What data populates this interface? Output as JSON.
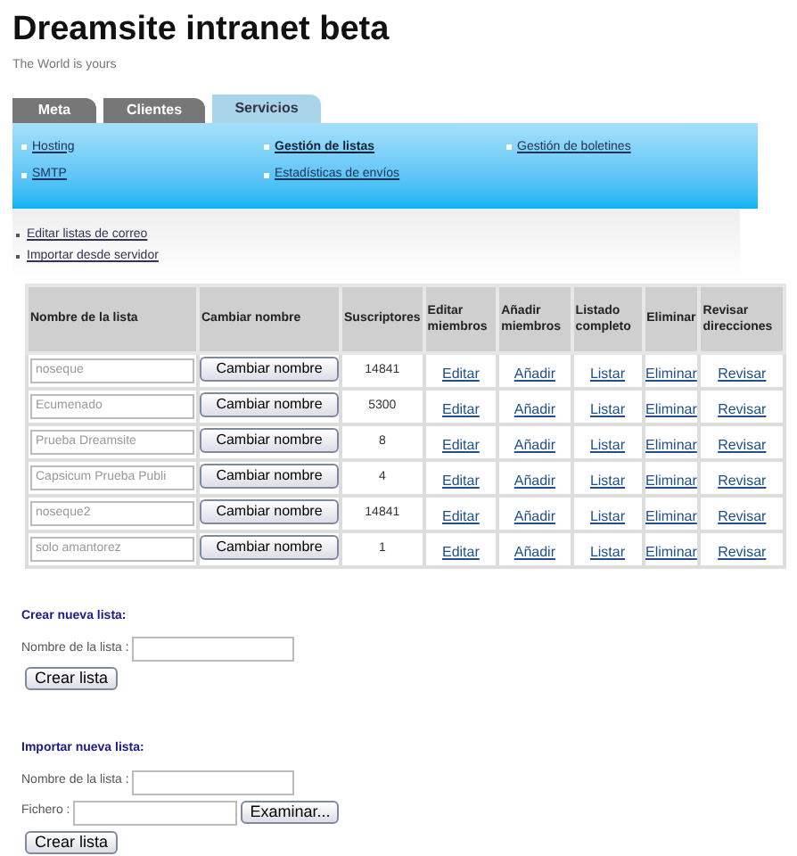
{
  "site": {
    "title": "Dreamsite intranet beta",
    "tagline": "The World is yours"
  },
  "tabs": [
    {
      "label": "Meta",
      "selected": false
    },
    {
      "label": "Clientes",
      "selected": false
    },
    {
      "label": "Servicios",
      "selected": true
    }
  ],
  "subnav": [
    {
      "label": "Hosting",
      "selected": false
    },
    {
      "label": "Gestión de listas",
      "selected": true
    },
    {
      "label": "Gestión de boletines",
      "selected": false
    },
    {
      "label": "SMTP",
      "selected": false
    },
    {
      "label": "Estadísticas de envíos",
      "selected": false
    }
  ],
  "side_links": [
    "Editar listas de correo",
    "Importar desde servidor"
  ],
  "table": {
    "columns": [
      "Nombre de la lista",
      "Cambiar nombre",
      "Suscriptores",
      "Editar miembros",
      "Añadir miembros",
      "Listado completo",
      "Eliminar",
      "Revisar direcciones"
    ],
    "rows": [
      {
        "name": "noseque",
        "button": "Cambiar nombre",
        "subscribers": "14841",
        "edit": "Editar",
        "add": "Añadir",
        "list": "Listar",
        "delete": "Eliminar",
        "review": "Revisar"
      },
      {
        "name": "Ecumenado",
        "button": "Cambiar nombre",
        "subscribers": "5300",
        "edit": "Editar",
        "add": "Añadir",
        "list": "Listar",
        "delete": "Eliminar",
        "review": "Revisar"
      },
      {
        "name": "Prueba Dreamsite",
        "button": "Cambiar nombre",
        "subscribers": "8",
        "edit": "Editar",
        "add": "Añadir",
        "list": "Listar",
        "delete": "Eliminar",
        "review": "Revisar"
      },
      {
        "name": "Capsicum Prueba Publi",
        "button": "Cambiar nombre",
        "subscribers": "4",
        "edit": "Editar",
        "add": "Añadir",
        "list": "Listar",
        "delete": "Eliminar",
        "review": "Revisar"
      },
      {
        "name": "noseque2",
        "button": "Cambiar nombre",
        "subscribers": "14841",
        "edit": "Editar",
        "add": "Añadir",
        "list": "Listar",
        "delete": "Eliminar",
        "review": "Revisar"
      },
      {
        "name": "solo amantorez",
        "button": "Cambiar nombre",
        "subscribers": "1",
        "edit": "Editar",
        "add": "Añadir",
        "list": "Listar",
        "delete": "Eliminar",
        "review": "Revisar"
      }
    ]
  },
  "create_form": {
    "heading": "Crear nueva lista:",
    "name_label": "Nombre de la lista :",
    "submit": "Crear lista"
  },
  "import_form": {
    "heading": "Importar nueva lista:",
    "name_label": "Nombre de la lista :",
    "file_label": "Fichero :",
    "browse": "Examinar...",
    "submit": "Crear lista"
  }
}
